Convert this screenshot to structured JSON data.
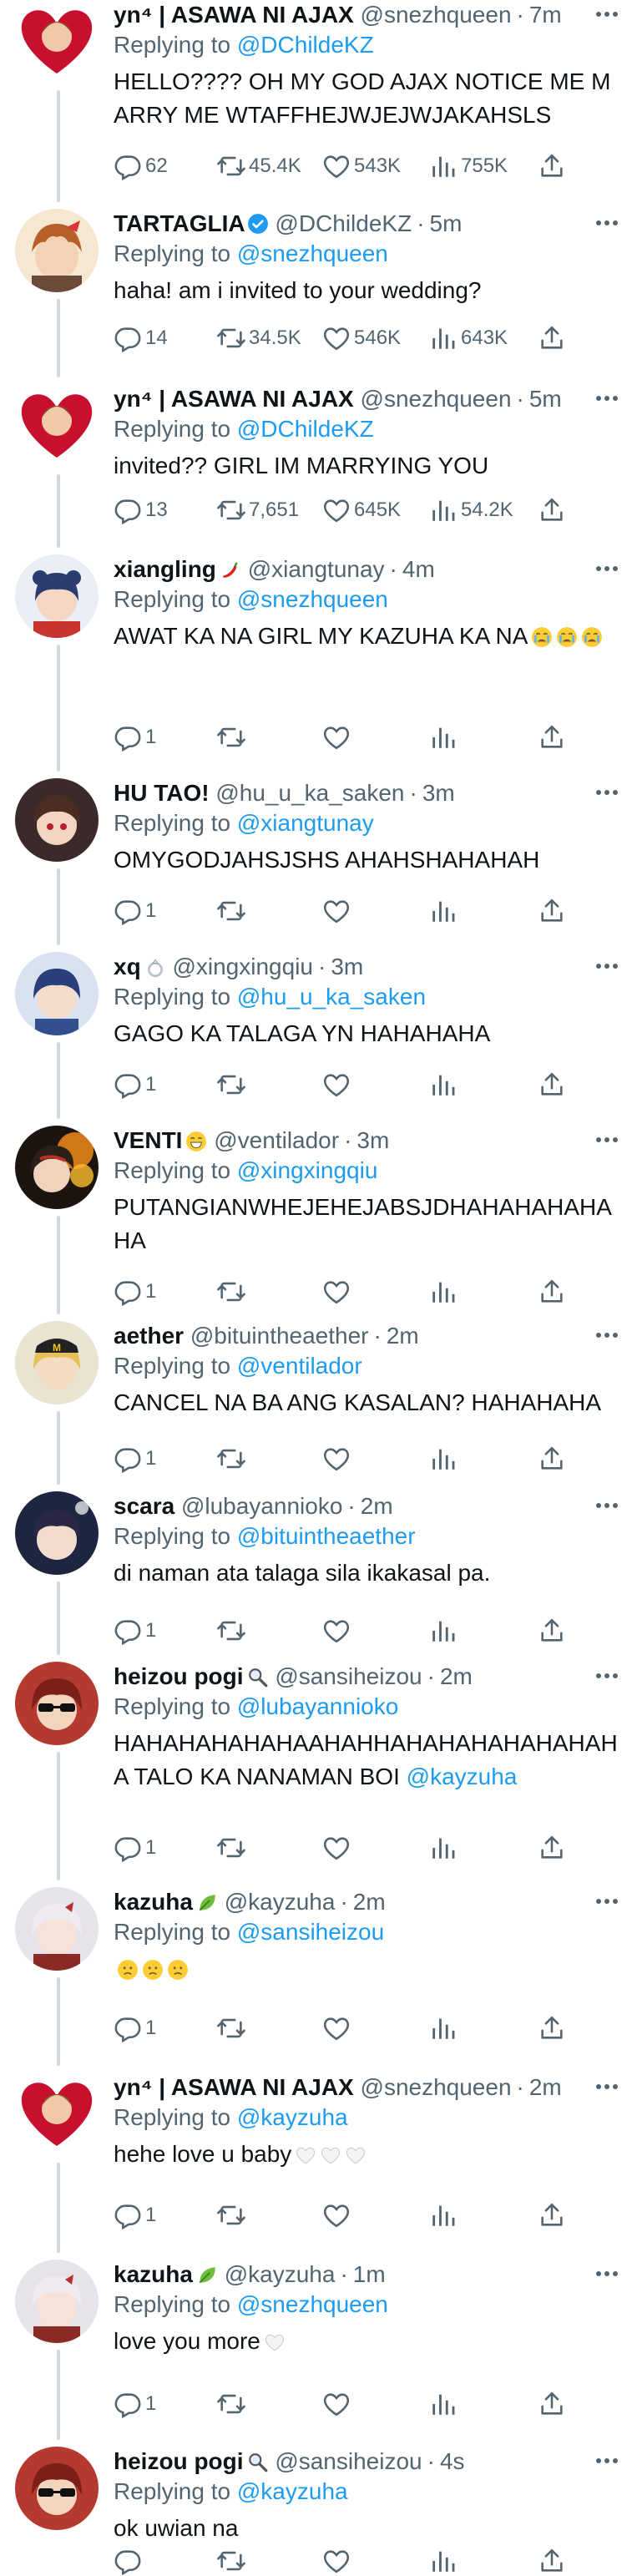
{
  "tweets": [
    {
      "name": "yn⁴ | ASAWA NI AJAX",
      "handle": "@snezhqueen",
      "time": "7m",
      "replying_to": "@DChildeKZ",
      "text": "HELLO???? OH MY GOD AJAX NOTICE ME MARRY ME WTAFFHEJWJEJWJAKAHSLS",
      "replies": "62",
      "retweets": "45.4K",
      "likes": "543K",
      "views": "755K",
      "avatar": "heart-avatar"
    },
    {
      "name": "TARTAGLIA",
      "handle": "@DChildeKZ",
      "time": "5m",
      "replying_to": "@snezhqueen",
      "text": "haha! am i invited to your wedding?",
      "replies": "14",
      "retweets": "34.5K",
      "likes": "546K",
      "views": "643K",
      "verified": true,
      "avatar": "tartaglia-avatar"
    },
    {
      "name": "yn⁴ | ASAWA NI AJAX",
      "handle": "@snezhqueen",
      "time": "5m",
      "replying_to": "@DChildeKZ",
      "text": "invited?? GIRL IM MARRYING YOU",
      "replies": "13",
      "retweets": "7,651",
      "likes": "645K",
      "views": "54.2K",
      "avatar": "heart-avatar"
    },
    {
      "name": "xiangling",
      "handle": "@xiangtunay",
      "time": "4m",
      "replying_to": "@snezhqueen",
      "text": "AWAT KA NA GIRL MY KAZUHA KA NA",
      "name_emoji": "chili-icon",
      "text_emoji": "crying-emoji",
      "replies": "1",
      "retweets": "",
      "likes": "",
      "views": "",
      "avatar": "xiangling-avatar"
    },
    {
      "name": "HU TAO!",
      "handle": "@hu_u_ka_saken",
      "time": "3m",
      "replying_to": "@xiangtunay",
      "text": "OMYGODJAHSJSHS AHAHSHAHAHAH",
      "replies": "1",
      "retweets": "",
      "likes": "",
      "views": "",
      "avatar": "hutao-avatar"
    },
    {
      "name": "xq",
      "handle": "@xingxingqiu",
      "time": "3m",
      "replying_to": "@hu_u_ka_saken",
      "text": "GAGO KA TALAGA YN HAHAHAHA",
      "name_emoji": "ring-icon",
      "replies": "1",
      "retweets": "",
      "likes": "",
      "views": "",
      "avatar": "xq-avatar"
    },
    {
      "name": "VENTI",
      "handle": "@ventilador",
      "time": "3m",
      "replying_to": "@xingxingqiu",
      "text": "PUTANGIANWHEJEHEJABSJDHAHAHAHAHAHA",
      "name_emoji": "grin-emoji",
      "replies": "1",
      "retweets": "",
      "likes": "",
      "views": "",
      "avatar": "venti-avatar"
    },
    {
      "name": "aether",
      "handle": "@bituintheaether",
      "time": "2m",
      "replying_to": "@ventilador",
      "text": "CANCEL NA BA ANG KASALAN? HAHAHAHA",
      "replies": "1",
      "retweets": "",
      "likes": "",
      "views": "",
      "avatar": "aether-avatar"
    },
    {
      "name": "scara",
      "handle": "@lubayannioko",
      "time": "2m",
      "replying_to": "@bituintheaether",
      "text": "di naman ata talaga sila ikakasal pa.",
      "replies": "1",
      "retweets": "",
      "likes": "",
      "views": "",
      "avatar": "scara-avatar"
    },
    {
      "name": "heizou pogi",
      "handle": "@sansiheizou",
      "time": "2m",
      "replying_to": "@lubayannioko",
      "text": "HAHAHAHAHAHAAHAHHAHAHAHAHAHAHAHA TALO KA NANAMAN BOI",
      "text_mention": "@kayzuha",
      "name_emoji": "magnifier-icon",
      "replies": "1",
      "retweets": "",
      "likes": "",
      "views": "",
      "avatar": "heizou-avatar"
    },
    {
      "name": "kazuha",
      "handle": "@kayzuha",
      "time": "2m",
      "replying_to": "@sansiheizou",
      "text": "",
      "name_emoji": "leaf-icon",
      "text_emoji": "frown-emoji",
      "replies": "1",
      "retweets": "",
      "likes": "",
      "views": "",
      "avatar": "kazuha-avatar"
    },
    {
      "name": "yn⁴ | ASAWA NI AJAX",
      "handle": "@snezhqueen",
      "time": "2m",
      "replying_to": "@kayzuha",
      "text": "hehe love u baby",
      "text_emoji": "white-heart-emoji",
      "replies": "1",
      "retweets": "",
      "likes": "",
      "views": "",
      "avatar": "heart-avatar"
    },
    {
      "name": "kazuha",
      "handle": "@kayzuha",
      "time": "1m",
      "replying_to": "@snezhqueen",
      "text": "love you more",
      "name_emoji": "leaf-icon",
      "text_emoji": "white-heart-emoji",
      "replies": "1",
      "retweets": "",
      "likes": "",
      "views": "",
      "avatar": "kazuha-avatar"
    },
    {
      "name": "heizou pogi",
      "handle": "@sansiheizou",
      "time": "4s",
      "replying_to": "@kayzuha",
      "text": "ok uwian na",
      "name_emoji": "magnifier-icon",
      "replies": "",
      "retweets": "",
      "likes": "",
      "views": "",
      "avatar": "heizou-avatar"
    }
  ],
  "labels": {
    "replying_prefix": "Replying to",
    "separator": "·"
  },
  "colors": {
    "link": "#1d9bf0",
    "muted": "#536471",
    "text": "#0f1419",
    "thread_line": "#cfd9de"
  }
}
